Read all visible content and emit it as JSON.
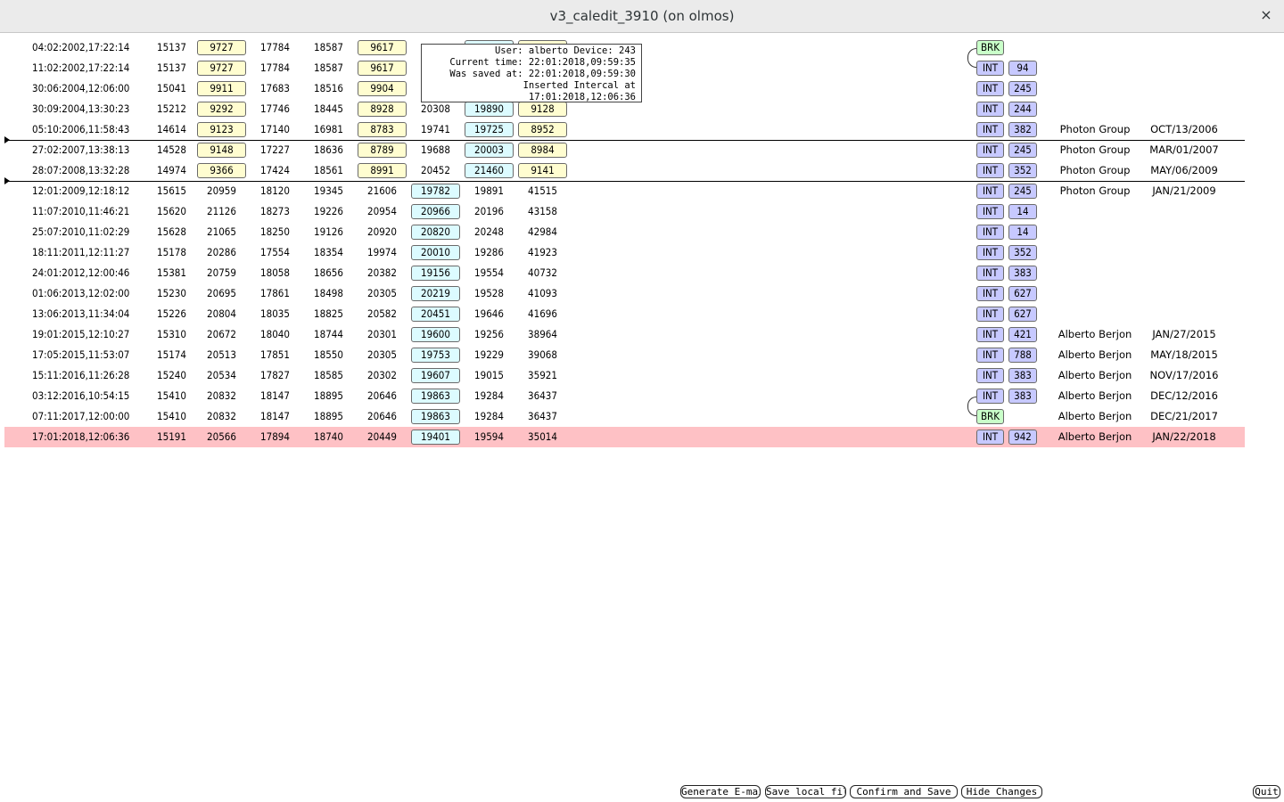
{
  "window": {
    "title": "v3_caledit_3910 (on olmos)",
    "close_glyph": "×"
  },
  "tooltip": {
    "line1": "User: alberto Device: 243",
    "line2": "Current time: 22:01:2018,09:59:35",
    "line3": "Was saved at: 22:01:2018,09:59:30",
    "line4": "Inserted Intercal at 17:01:2018,12:06:36"
  },
  "rows": [
    {
      "ts": "04:02:2002,17:22:14",
      "c1": "15137",
      "c2": "9727",
      "c3": "17784",
      "c4": "18587",
      "c5": "9617",
      "c6": "",
      "c7": "",
      "c8": "",
      "tag": "BRK",
      "num": "",
      "who": "",
      "date": ""
    },
    {
      "ts": "11:02:2002,17:22:14",
      "c1": "15137",
      "c2": "9727",
      "c3": "17784",
      "c4": "18587",
      "c5": "9617",
      "c6": "",
      "c7": "",
      "c8": "",
      "tag": "INT",
      "num": "94",
      "who": "",
      "date": ""
    },
    {
      "ts": "30:06:2004,12:06:00",
      "c1": "15041",
      "c2": "9911",
      "c3": "17683",
      "c4": "18516",
      "c5": "9904",
      "c6": "",
      "c7": "",
      "c8": "",
      "tag": "INT",
      "num": "245",
      "who": "",
      "date": ""
    },
    {
      "ts": "30:09:2004,13:30:23",
      "c1": "15212",
      "c2": "9292",
      "c3": "17746",
      "c4": "18445",
      "c5": "8928",
      "c6": "20308",
      "c7": "19890",
      "c8": "9128",
      "tag": "INT",
      "num": "244",
      "who": "",
      "date": ""
    },
    {
      "ts": "05:10:2006,11:58:43",
      "c1": "14614",
      "c2": "9123",
      "c3": "17140",
      "c4": "16981",
      "c5": "8783",
      "c6": "19741",
      "c7": "19725",
      "c8": "8952",
      "tag": "INT",
      "num": "382",
      "who": "Photon Group",
      "date": "OCT/13/2006"
    },
    {
      "ts": "27:02:2007,13:38:13",
      "c1": "14528",
      "c2": "9148",
      "c3": "17227",
      "c4": "18636",
      "c5": "8789",
      "c6": "19688",
      "c7": "20003",
      "c8": "8984",
      "tag": "INT",
      "num": "245",
      "who": "Photon Group",
      "date": "MAR/01/2007"
    },
    {
      "ts": "28:07:2008,13:32:28",
      "c1": "14974",
      "c2": "9366",
      "c3": "17424",
      "c4": "18561",
      "c5": "8991",
      "c6": "20452",
      "c7": "21460",
      "c8": "9141",
      "tag": "INT",
      "num": "352",
      "who": "Photon Group",
      "date": "MAY/06/2009"
    },
    {
      "ts": "12:01:2009,12:18:12",
      "c1": "15615",
      "c2": "20959",
      "c3": "18120",
      "c4": "19345",
      "c5": "21606",
      "c6": "19782",
      "c7": "19891",
      "c8": "41515",
      "tag": "INT",
      "num": "245",
      "who": "Photon Group",
      "date": "JAN/21/2009"
    },
    {
      "ts": "11:07:2010,11:46:21",
      "c1": "15620",
      "c2": "21126",
      "c3": "18273",
      "c4": "19226",
      "c5": "20954",
      "c6": "20966",
      "c7": "20196",
      "c8": "43158",
      "tag": "INT",
      "num": "14",
      "who": "",
      "date": ""
    },
    {
      "ts": "25:07:2010,11:02:29",
      "c1": "15628",
      "c2": "21065",
      "c3": "18250",
      "c4": "19126",
      "c5": "20920",
      "c6": "20820",
      "c7": "20248",
      "c8": "42984",
      "tag": "INT",
      "num": "14",
      "who": "",
      "date": ""
    },
    {
      "ts": "18:11:2011,12:11:27",
      "c1": "15178",
      "c2": "20286",
      "c3": "17554",
      "c4": "18354",
      "c5": "19974",
      "c6": "20010",
      "c7": "19286",
      "c8": "41923",
      "tag": "INT",
      "num": "352",
      "who": "",
      "date": ""
    },
    {
      "ts": "24:01:2012,12:00:46",
      "c1": "15381",
      "c2": "20759",
      "c3": "18058",
      "c4": "18656",
      "c5": "20382",
      "c6": "19156",
      "c7": "19554",
      "c8": "40732",
      "tag": "INT",
      "num": "383",
      "who": "",
      "date": ""
    },
    {
      "ts": "01:06:2013,12:02:00",
      "c1": "15230",
      "c2": "20695",
      "c3": "17861",
      "c4": "18498",
      "c5": "20305",
      "c6": "20219",
      "c7": "19528",
      "c8": "41093",
      "tag": "INT",
      "num": "627",
      "who": "",
      "date": ""
    },
    {
      "ts": "13:06:2013,11:34:04",
      "c1": "15226",
      "c2": "20804",
      "c3": "18035",
      "c4": "18825",
      "c5": "20582",
      "c6": "20451",
      "c7": "19646",
      "c8": "41696",
      "tag": "INT",
      "num": "627",
      "who": "",
      "date": ""
    },
    {
      "ts": "19:01:2015,12:10:27",
      "c1": "15310",
      "c2": "20672",
      "c3": "18040",
      "c4": "18744",
      "c5": "20301",
      "c6": "19600",
      "c7": "19256",
      "c8": "38964",
      "tag": "INT",
      "num": "421",
      "who": "Alberto Berjon",
      "date": "JAN/27/2015"
    },
    {
      "ts": "17:05:2015,11:53:07",
      "c1": "15174",
      "c2": "20513",
      "c3": "17851",
      "c4": "18550",
      "c5": "20305",
      "c6": "19753",
      "c7": "19229",
      "c8": "39068",
      "tag": "INT",
      "num": "788",
      "who": "Alberto Berjon",
      "date": "MAY/18/2015"
    },
    {
      "ts": "15:11:2016,11:26:28",
      "c1": "15240",
      "c2": "20534",
      "c3": "17827",
      "c4": "18585",
      "c5": "20302",
      "c6": "19607",
      "c7": "19015",
      "c8": "35921",
      "tag": "INT",
      "num": "383",
      "who": "Alberto Berjon",
      "date": "NOV/17/2016"
    },
    {
      "ts": "03:12:2016,10:54:15",
      "c1": "15410",
      "c2": "20832",
      "c3": "18147",
      "c4": "18895",
      "c5": "20646",
      "c6": "19863",
      "c7": "19284",
      "c8": "36437",
      "tag": "INT",
      "num": "383",
      "who": "Alberto Berjon",
      "date": "DEC/12/2016"
    },
    {
      "ts": "07:11:2017,12:00:00",
      "c1": "15410",
      "c2": "20832",
      "c3": "18147",
      "c4": "18895",
      "c5": "20646",
      "c6": "19863",
      "c7": "19284",
      "c8": "36437",
      "tag": "BRK",
      "num": "",
      "who": "Alberto Berjon",
      "date": "DEC/21/2017"
    },
    {
      "ts": "17:01:2018,12:06:36",
      "c1": "15191",
      "c2": "20566",
      "c3": "17894",
      "c4": "18740",
      "c5": "20449",
      "c6": "19401",
      "c7": "19594",
      "c8": "35014",
      "tag": "INT",
      "num": "942",
      "who": "Alberto Berjon",
      "date": "JAN/22/2018"
    }
  ],
  "buttons": {
    "email": "Generate E-mail",
    "save_local": "Save local file",
    "confirm": "Confirm and Save",
    "hide": "Hide Changes",
    "quit": "Quit"
  },
  "colors": {
    "yellow_box": "#fffdd0",
    "cyan_box": "#dcfbff",
    "int_tag": "#c7c9ff",
    "brk_tag": "#c9ffc9",
    "highlight_row": "#fec1c5"
  }
}
